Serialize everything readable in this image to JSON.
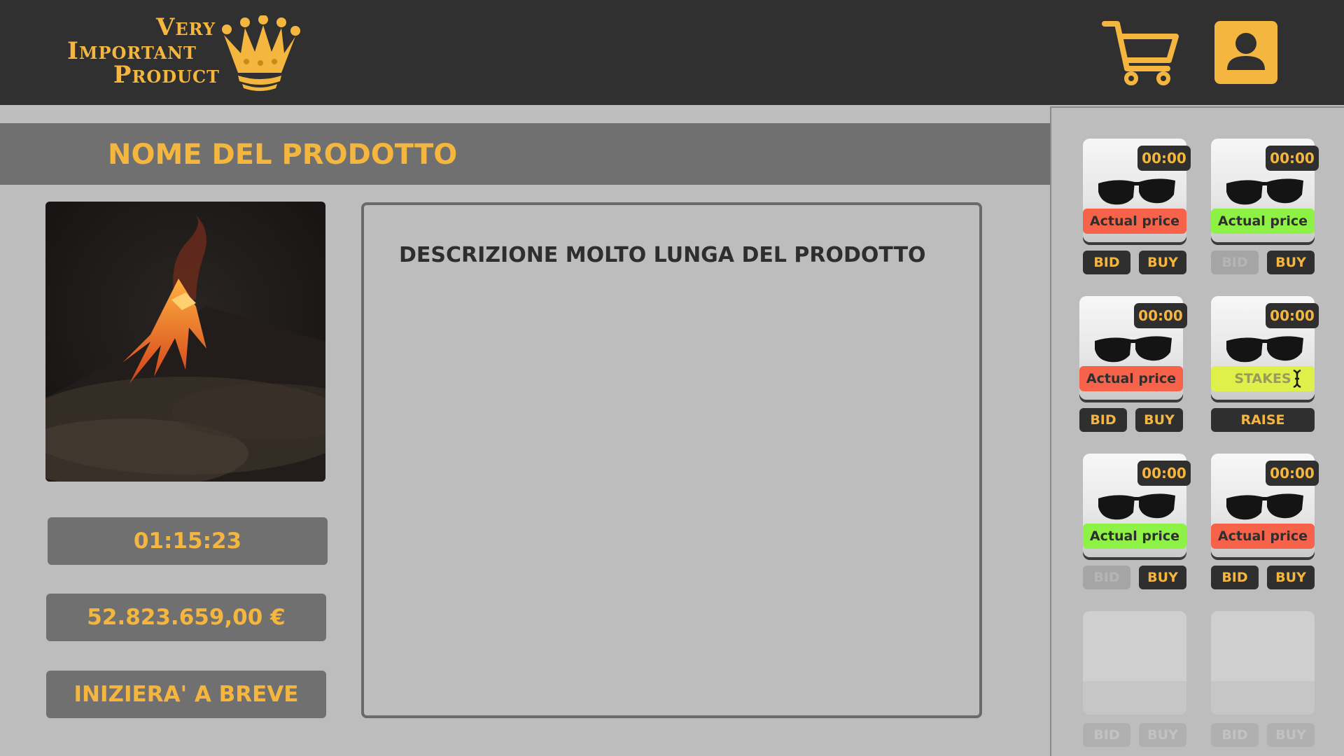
{
  "header": {
    "logo_lines": [
      "Very",
      "Important",
      "Product"
    ],
    "cart_icon": "cart-icon",
    "user_icon": "user-icon"
  },
  "product": {
    "title": "NOME DEL PRODOTTO",
    "description": "DESCRIZIONE MOLTO LUNGA DEL PRODOTTO",
    "timer": "01:15:23",
    "price": "52.823.659,00 €",
    "status": "INIZIERA' A BREVE"
  },
  "colors": {
    "accent": "#f4b63e",
    "topbar": "#303030",
    "band": "#707070",
    "background": "#bdbdbd",
    "price_red": "#f7634a",
    "price_green": "#8ef246",
    "price_yellow": "#dff04a"
  },
  "sidebar": {
    "cards": [
      {
        "time": "00:00",
        "price_label": "Actual price",
        "price_state": "red",
        "bid_label": "BID",
        "buy_label": "BUY",
        "bid_enabled": true
      },
      {
        "time": "00:00",
        "price_label": "Actual price",
        "price_state": "green",
        "bid_label": "BID",
        "buy_label": "BUY",
        "bid_enabled": false
      },
      {
        "time": "00:00",
        "price_label": "Actual price",
        "price_state": "red",
        "bid_label": "BID",
        "buy_label": "BUY",
        "bid_enabled": true
      },
      {
        "time": "00:00",
        "price_label": "STAKES",
        "price_state": "input",
        "raise_label": "RAISE"
      },
      {
        "time": "00:00",
        "price_label": "Actual price",
        "price_state": "green",
        "bid_label": "BID",
        "buy_label": "BUY",
        "bid_enabled": false
      },
      {
        "time": "00:00",
        "price_label": "Actual price",
        "price_state": "red",
        "bid_label": "BID",
        "buy_label": "BUY",
        "bid_enabled": true
      },
      {
        "empty": true,
        "bid_label": "BID",
        "buy_label": "BUY"
      },
      {
        "empty": true,
        "bid_label": "BID",
        "buy_label": "BUY"
      }
    ]
  }
}
